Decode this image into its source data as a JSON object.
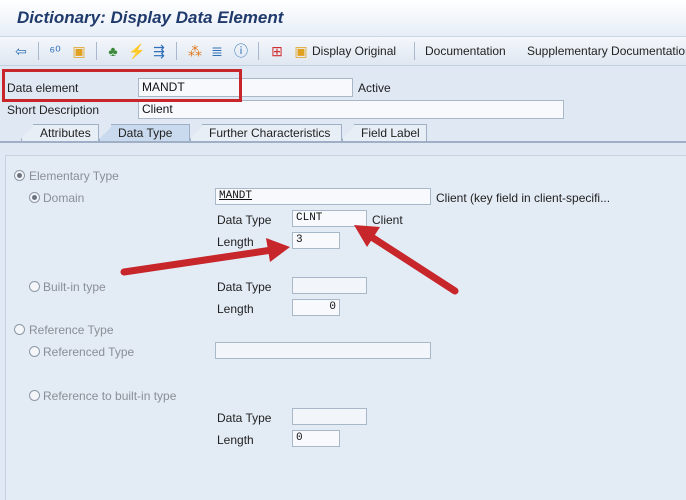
{
  "title": "Dictionary: Display Data Element",
  "toolbar": {
    "icons": [
      "back-arrow-icon",
      "glasses-edit-icon",
      "other-object-icon",
      "check-icon",
      "activate-icon",
      "where-used-icon",
      "object-list-icon",
      "menu-icon",
      "info-icon",
      "technical-settings-icon",
      "display-original-icon"
    ],
    "display_original": "Display Original",
    "documentation": "Documentation",
    "supplementary": "Supplementary Documentation"
  },
  "header": {
    "data_element_label": "Data element",
    "data_element_value": "MANDT",
    "status": "Active",
    "short_desc_label": "Short Description",
    "short_desc_value": "Client"
  },
  "tabs": [
    "Attributes",
    "Data Type",
    "Further Characteristics",
    "Field Label"
  ],
  "active_tab": "Data Type",
  "form": {
    "elementary_type": "Elementary Type",
    "domain_label": "Domain",
    "domain_value": "MANDT",
    "domain_desc": "Client (key field in client-specifi...",
    "data_type_label": "Data Type",
    "data_type_value": "CLNT",
    "data_type_desc": "Client",
    "length_label": "Length",
    "length_value": "3",
    "builtin_type": "Built-in type",
    "builtin_data_type_label": "Data Type",
    "builtin_length_label": "Length",
    "builtin_length_value": "0",
    "reference_type": "Reference Type",
    "referenced_type": "Referenced Type",
    "ref_builtin": "Reference to built-in type",
    "ref_data_type_label": "Data Type",
    "ref_length_label": "Length",
    "ref_length_value": "0"
  },
  "colors": {
    "annotation_red": "#c7262b",
    "title_blue": "#1f3a6b"
  }
}
